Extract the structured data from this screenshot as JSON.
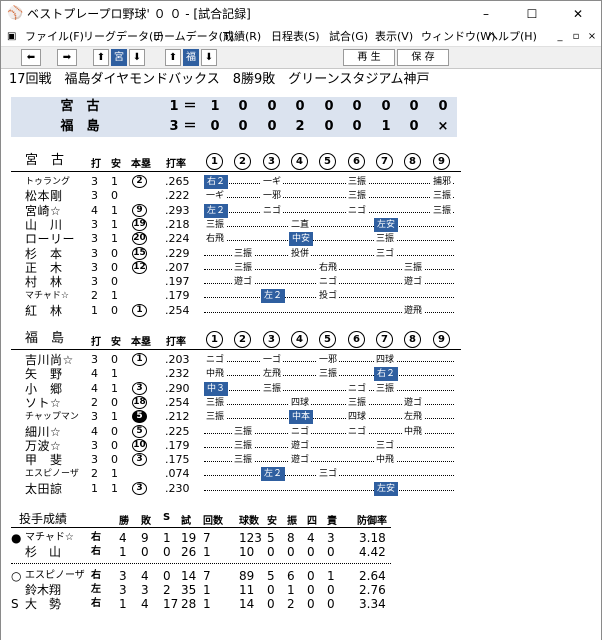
{
  "window": {
    "title": "ベストプレープロ野球' ０ ０ - [試合記録]",
    "min": "–",
    "max": "☐",
    "close": "✕"
  },
  "menu": [
    "ファイル(F)",
    "リーグデータ(L)",
    "チームデータ(T)",
    "成績(R)",
    "日程表(S)",
    "試合(G)",
    "表示(V)",
    "ウィンドウ(W)",
    "ヘルプ(H)"
  ],
  "mdi_buttons": [
    "_",
    "▫",
    "×"
  ],
  "toolbar": {
    "prev": "⬅",
    "next": "➡",
    "team1": "宮",
    "team2": "福",
    "up": "⬆",
    "down": "⬇",
    "play": "再 生",
    "save": "保 存"
  },
  "game_title": "17回戦　福島ダイヤモンドバックス　8勝9敗　グリーンスタジアム神戸",
  "score": {
    "teams": [
      {
        "name": "宮　古",
        "runs": "1",
        "eq": "＝",
        "innings": [
          "1",
          "0",
          "0",
          "0",
          "0",
          "0",
          "0",
          "0",
          "0"
        ]
      },
      {
        "name": "福　島",
        "runs": "3",
        "eq": "＝",
        "innings": [
          "0",
          "0",
          "0",
          "2",
          "0",
          "0",
          "1",
          "0",
          "×"
        ]
      }
    ]
  },
  "batting_headers": {
    "ab": "打",
    "h": "安",
    "hr": "本塁",
    "avg": "打率"
  },
  "innings_labels": [
    "1",
    "2",
    "3",
    "4",
    "5",
    "6",
    "7",
    "8",
    "9"
  ],
  "away": {
    "team": "宮　古",
    "batters": [
      {
        "name": "トゥラング",
        "ab": "3",
        "h": "1",
        "hr": "2",
        "avg": ".265",
        "plays": [
          "右２",
          "",
          "一ギ",
          "",
          "",
          "三振",
          "",
          "",
          "捕邪"
        ],
        "hl": [
          0
        ]
      },
      {
        "name": "松本剛",
        "ab": "3",
        "h": "0",
        "hr": "",
        "avg": ".222",
        "plays": [
          "一ギ",
          "",
          "一邪",
          "",
          "",
          "三振",
          "",
          "",
          "三振"
        ],
        "hl": []
      },
      {
        "name": "宮崎☆",
        "ab": "4",
        "h": "1",
        "hr": "9",
        "avg": ".293",
        "plays": [
          "左２",
          "",
          "ニゴ",
          "",
          "",
          "ニゴ",
          "",
          "",
          "三振"
        ],
        "hl": [
          0
        ]
      },
      {
        "name": "山　川",
        "ab": "3",
        "h": "1",
        "hr": "19",
        "avg": ".218",
        "plays": [
          "三振",
          "",
          "",
          "二直",
          "",
          "",
          "左安",
          "",
          ""
        ],
        "hl": [
          6
        ]
      },
      {
        "name": "ローリー",
        "ab": "3",
        "h": "1",
        "hr": "20",
        "avg": ".224",
        "plays": [
          "右飛",
          "",
          "",
          "中安",
          "",
          "",
          "三振",
          "",
          ""
        ],
        "hl": [
          3
        ]
      },
      {
        "name": "杉　本",
        "ab": "3",
        "h": "0",
        "hr": "15",
        "avg": ".229",
        "plays": [
          "",
          "三振",
          "",
          "投併",
          "",
          "",
          "三ゴ",
          "",
          ""
        ],
        "hl": []
      },
      {
        "name": "正　木",
        "ab": "3",
        "h": "0",
        "hr": "12",
        "avg": ".207",
        "plays": [
          "",
          "三振",
          "",
          "",
          "右飛",
          "",
          "",
          "三振",
          ""
        ],
        "hl": []
      },
      {
        "name": "村　林",
        "ab": "3",
        "h": "0",
        "hr": "",
        "avg": ".197",
        "plays": [
          "",
          "遊ゴ",
          "",
          "",
          "ニゴ",
          "",
          "",
          "遊ゴ",
          ""
        ],
        "hl": []
      },
      {
        "name": "マチャド☆",
        "ab": "2",
        "h": "1",
        "hr": "",
        "avg": ".179",
        "plays": [
          "",
          "",
          "左２",
          "",
          "投ゴ",
          "",
          "",
          "",
          ""
        ],
        "hl": [
          2
        ]
      },
      {
        "name": "紅　林",
        "ab": "1",
        "h": "0",
        "hr": "1",
        "avg": ".254",
        "plays": [
          "",
          "",
          "",
          "",
          "",
          "",
          "",
          "遊飛",
          ""
        ],
        "hl": []
      }
    ]
  },
  "home": {
    "team": "福　島",
    "batters": [
      {
        "name": "吉川尚☆",
        "ab": "3",
        "h": "0",
        "hr": "1",
        "avg": ".203",
        "plays": [
          "ニゴ",
          "",
          "一ゴ",
          "",
          "一邪",
          "",
          "四球",
          "",
          ""
        ],
        "hl": []
      },
      {
        "name": "矢　野",
        "ab": "4",
        "h": "1",
        "hr": "",
        "avg": ".232",
        "plays": [
          "中飛",
          "",
          "左飛",
          "",
          "三振",
          "",
          "右２",
          "",
          ""
        ],
        "hl": [
          6
        ]
      },
      {
        "name": "小　郷",
        "ab": "4",
        "h": "1",
        "hr": "3",
        "avg": ".290",
        "plays": [
          "中３",
          "",
          "三振",
          "",
          "",
          "ニゴ",
          "三振",
          "",
          ""
        ],
        "hl": [
          0
        ]
      },
      {
        "name": "ソト☆",
        "ab": "2",
        "h": "0",
        "hr": "18",
        "avg": ".254",
        "plays": [
          "三振",
          "",
          "",
          "四球",
          "",
          "三振",
          "",
          "遊ゴ",
          ""
        ],
        "hl": []
      },
      {
        "name": "チャップマン",
        "ab": "3",
        "h": "1",
        "hr": "5",
        "avg": ".212",
        "plays": [
          "三振",
          "",
          "",
          "中本",
          "",
          "四球",
          "",
          "左飛",
          ""
        ],
        "hl": [
          3
        ],
        "hrfill": true
      },
      {
        "name": "細川☆",
        "ab": "4",
        "h": "0",
        "hr": "5",
        "avg": ".225",
        "plays": [
          "",
          "三振",
          "",
          "ニゴ",
          "",
          "ニゴ",
          "",
          "中飛",
          ""
        ],
        "hl": []
      },
      {
        "name": "万波☆",
        "ab": "3",
        "h": "0",
        "hr": "10",
        "avg": ".179",
        "plays": [
          "",
          "三振",
          "",
          "遊ゴ",
          "",
          "",
          "三ゴ",
          "",
          ""
        ],
        "hl": []
      },
      {
        "name": "甲　斐",
        "ab": "3",
        "h": "0",
        "hr": "3",
        "avg": ".175",
        "plays": [
          "",
          "三振",
          "",
          "遊ゴ",
          "",
          "",
          "中飛",
          "",
          ""
        ],
        "hl": []
      },
      {
        "name": "エスピノーザ",
        "ab": "2",
        "h": "1",
        "hr": "",
        "avg": ".074",
        "plays": [
          "",
          "",
          "左２",
          "",
          "三ゴ",
          "",
          "",
          "",
          ""
        ],
        "hl": [
          2
        ]
      },
      {
        "name": "太田諒",
        "ab": "1",
        "h": "1",
        "hr": "3",
        "avg": ".230",
        "plays": [
          "",
          "",
          "",
          "",
          "",
          "",
          "左安",
          "",
          ""
        ],
        "hl": [
          6
        ]
      }
    ]
  },
  "pitching": {
    "title": "投手成績",
    "headers": [
      "勝",
      "敗",
      "S",
      "試",
      "回数",
      "球数",
      "安",
      "振",
      "四",
      "責",
      "防御率"
    ],
    "away": [
      {
        "mark": "●",
        "name": "マチャド☆",
        "hand": "右",
        "stats": [
          "4",
          "9",
          "1",
          "19",
          "7",
          "123",
          "5",
          "8",
          "4",
          "3",
          "3.18"
        ]
      },
      {
        "mark": "",
        "name": "杉　山",
        "hand": "右",
        "stats": [
          "1",
          "0",
          "0",
          "26",
          "1",
          "10",
          "0",
          "0",
          "0",
          "0",
          "4.42"
        ]
      }
    ],
    "home": [
      {
        "mark": "○",
        "name": "エスピノーザ",
        "hand": "右",
        "stats": [
          "3",
          "4",
          "0",
          "14",
          "7",
          "89",
          "5",
          "6",
          "0",
          "1",
          "2.64"
        ]
      },
      {
        "mark": "",
        "name": "鈴木翔",
        "hand": "左",
        "stats": [
          "3",
          "3",
          "2",
          "35",
          "1",
          "11",
          "0",
          "1",
          "0",
          "0",
          "2.76"
        ]
      },
      {
        "mark": "S",
        "name": "大　勢",
        "hand": "右",
        "stats": [
          "1",
          "4",
          "17",
          "28",
          "1",
          "14",
          "0",
          "2",
          "0",
          "0",
          "3.34"
        ]
      }
    ]
  }
}
